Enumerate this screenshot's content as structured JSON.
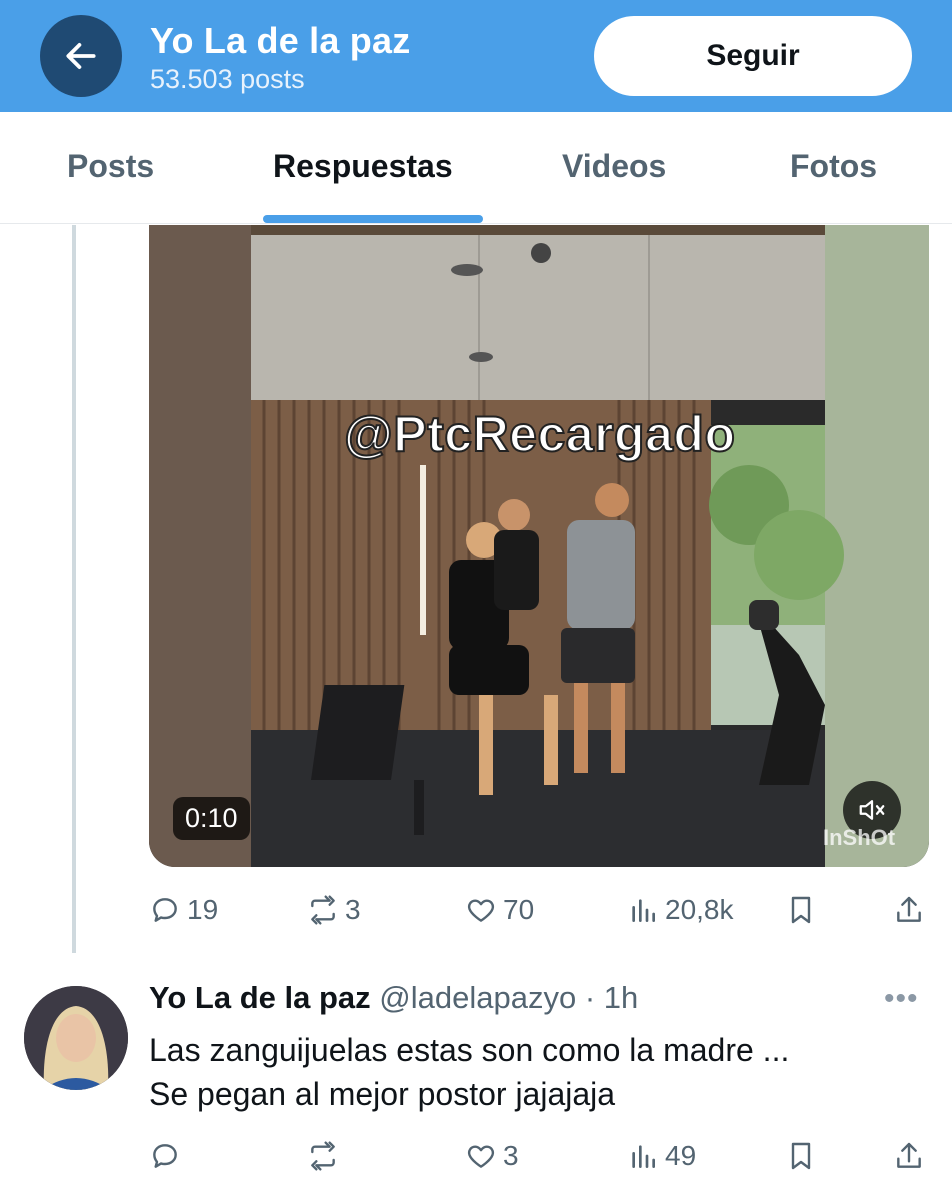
{
  "header": {
    "profile_name": "Yo La de la paz",
    "posts_count": "53.503 posts",
    "follow_label": "Seguir",
    "back_icon": "arrow-left-icon"
  },
  "tabs": [
    {
      "label": "Posts",
      "active": false
    },
    {
      "label": "Respuestas",
      "active": true
    },
    {
      "label": "Videos",
      "active": false
    },
    {
      "label": "Fotos",
      "active": false
    }
  ],
  "video_post": {
    "watermark": "@PtcRecargado",
    "duration": "0:10",
    "brand_mark": "InShOt",
    "stats": {
      "replies": "19",
      "reposts": "3",
      "likes": "70",
      "views": "20,8k"
    }
  },
  "reply_tweet": {
    "name": "Yo La de la paz",
    "meta": "@ladelapazyo · 1h",
    "text": "Las zanguijuelas estas son como la madre ...\nSe pegan al mejor postor jajajaja",
    "stats": {
      "replies": "",
      "reposts": "",
      "likes": "3",
      "views": "49"
    }
  },
  "colors": {
    "header_bg": "#4a9fe8",
    "back_button_bg": "#1f4a73",
    "accent": "#4a9fe8",
    "muted_text": "#536471"
  }
}
